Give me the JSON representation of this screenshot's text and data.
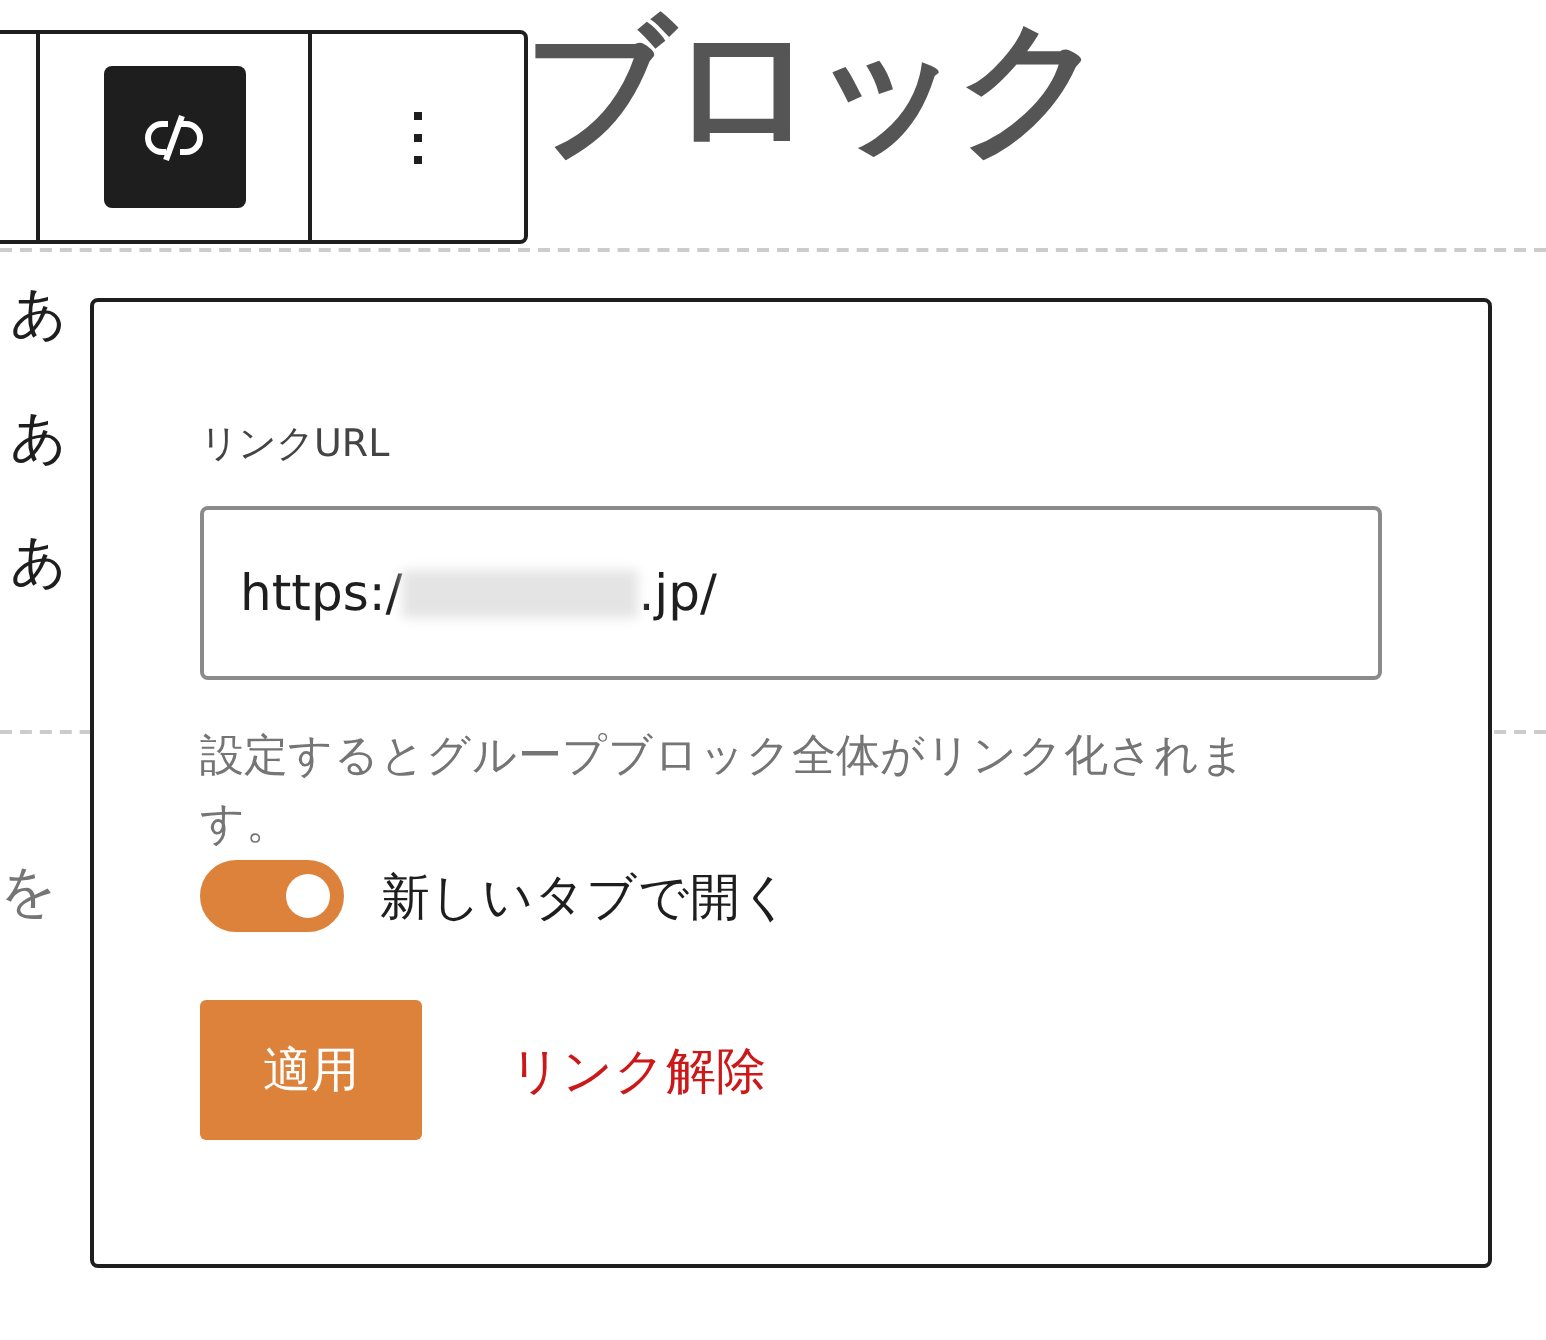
{
  "heading": "ブロック",
  "paragraphs": [
    "あ",
    "あ",
    "あ"
  ],
  "placeholder_fragment": "を",
  "toolbar": {
    "unlink_selected": true
  },
  "link_popover": {
    "label": "リンクURL",
    "url_start": "https:/",
    "url_redacted": true,
    "url_end": ".jp/",
    "help": "設定するとグループブロック全体がリンク化されます。",
    "new_tab": {
      "label": "新しいタブで開く",
      "on": true
    },
    "apply_button": "適用",
    "unlink_button": "リンク解除"
  }
}
